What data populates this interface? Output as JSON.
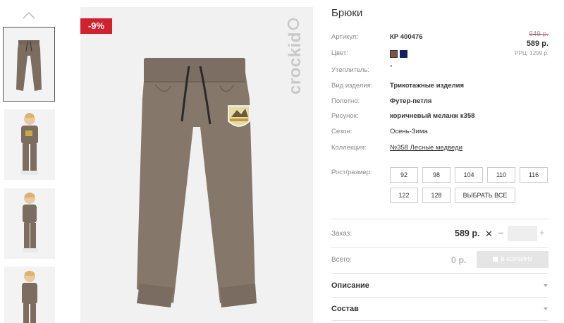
{
  "product": {
    "title": "Брюки",
    "discount": "-9%",
    "old_price": "649 р.",
    "price": "589 р.",
    "rrp": "РРЦ: 1299 р.",
    "brand_logo": "crockid"
  },
  "details": {
    "article_label": "Артикул:",
    "article_value": "КР 400476",
    "color_label": "Цвет:",
    "insulation_label": "Утеплитель:",
    "insulation_value": "\"",
    "type_label": "Вид изделия:",
    "type_value": "Трикотажные изделия",
    "fabric_label": "Полотно:",
    "fabric_value": "Футер-петля",
    "pattern_label": "Рисунок:",
    "pattern_value": "коричневый меланж к358",
    "season_label": "Сезон:",
    "season_value": "Осень-Зима",
    "collection_label": "Коллекция:",
    "collection_value": "№358 Лесные медведи"
  },
  "colors": [
    "#7a5548",
    "#16205e"
  ],
  "sizes": {
    "label": "Рост/размер:",
    "items": [
      "92",
      "98",
      "104",
      "110",
      "116",
      "122",
      "128"
    ],
    "select_all": "ВЫБРАТЬ ВСЕ"
  },
  "order": {
    "label": "Заказ:",
    "price": "589 р.",
    "times": "✕",
    "minus": "−",
    "plus": "+",
    "quantity": ""
  },
  "total": {
    "label": "Всего:",
    "value": "0 р.",
    "cart_button": "В КОРЗИНУ"
  },
  "accordion": {
    "description": "Описание",
    "composition": "Состав"
  }
}
